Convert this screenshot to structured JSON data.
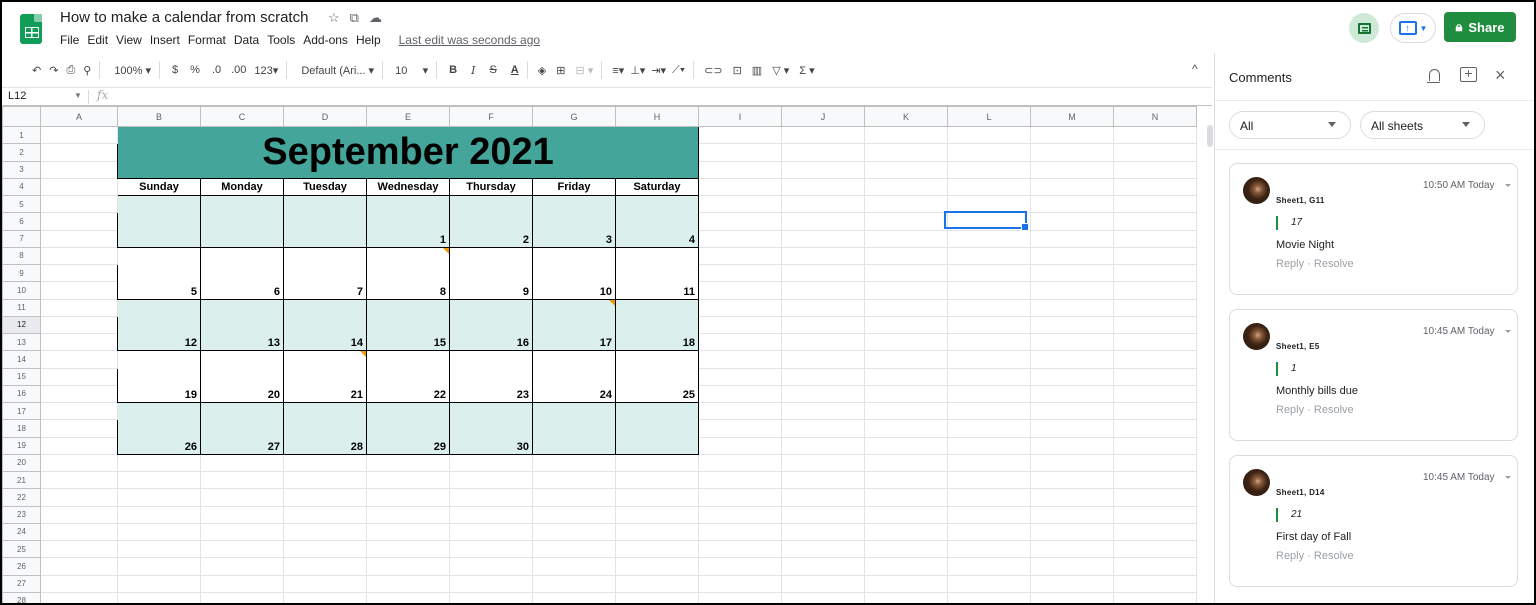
{
  "app": {
    "title": "How to make a calendar from scratch",
    "last_edit": "Last edit was seconds ago",
    "share_label": "Share"
  },
  "menu": [
    "File",
    "Edit",
    "View",
    "Insert",
    "Format",
    "Data",
    "Tools",
    "Add-ons",
    "Help"
  ],
  "toolbar": {
    "zoom": "100%",
    "currency": "$",
    "percent": "%",
    "decimal_less": ".0",
    "decimal_more": ".00",
    "number_format": "123",
    "font": "Default (Ari...",
    "font_size": "10",
    "bold": "B",
    "italic": "I",
    "strikethrough": "S",
    "text_color": "A",
    "sum": "Σ"
  },
  "formula_bar": {
    "cell_ref": "L12",
    "fx": "fx",
    "value": ""
  },
  "columns": [
    "A",
    "B",
    "C",
    "D",
    "E",
    "F",
    "G",
    "H",
    "I",
    "J",
    "K",
    "L",
    "M",
    "N"
  ],
  "selected_column": "L",
  "selected_row": "12",
  "rows": [
    "1",
    "2",
    "3",
    "4",
    "5",
    "6",
    "7",
    "8",
    "9",
    "10",
    "11",
    "12",
    "13",
    "14",
    "15",
    "16",
    "17",
    "18",
    "19",
    "20",
    "21",
    "22",
    "23",
    "24",
    "25",
    "26",
    "27",
    "28"
  ],
  "calendar": {
    "title": "September 2021",
    "days": [
      "Sunday",
      "Monday",
      "Tuesday",
      "Wednesday",
      "Thursday",
      "Friday",
      "Saturday"
    ],
    "weeks": [
      [
        "",
        "",
        "",
        "1",
        "2",
        "3",
        "4"
      ],
      [
        "5",
        "6",
        "7",
        "8",
        "9",
        "10",
        "11"
      ],
      [
        "12",
        "13",
        "14",
        "15",
        "16",
        "17",
        "18"
      ],
      [
        "19",
        "20",
        "21",
        "22",
        "23",
        "24",
        "25"
      ],
      [
        "26",
        "27",
        "28",
        "29",
        "30",
        "",
        ""
      ]
    ],
    "colors": {
      "title_bg": "#44a59a",
      "tint_bg": "#dbf0ed",
      "comment_marker": "#f29900"
    }
  },
  "comments_panel": {
    "title": "Comments",
    "filter_1": "All",
    "filter_2": "All sheets",
    "comments": [
      {
        "ref": "Sheet1, G11",
        "time": "10:50 AM Today",
        "quote": "17",
        "text": "Movie Night",
        "reply": "Reply",
        "sep": "·",
        "resolve": "Resolve"
      },
      {
        "ref": "Sheet1, E5",
        "time": "10:45 AM Today",
        "quote": "1",
        "text": "Monthly bills due",
        "reply": "Reply",
        "sep": "·",
        "resolve": "Resolve"
      },
      {
        "ref": "Sheet1, D14",
        "time": "10:45 AM Today",
        "quote": "21",
        "text": "First day of Fall",
        "reply": "Reply",
        "sep": "·",
        "resolve": "Resolve"
      }
    ]
  },
  "colors": {
    "brand_green": "#1e8e3e",
    "selection_blue": "#1a73e8"
  }
}
